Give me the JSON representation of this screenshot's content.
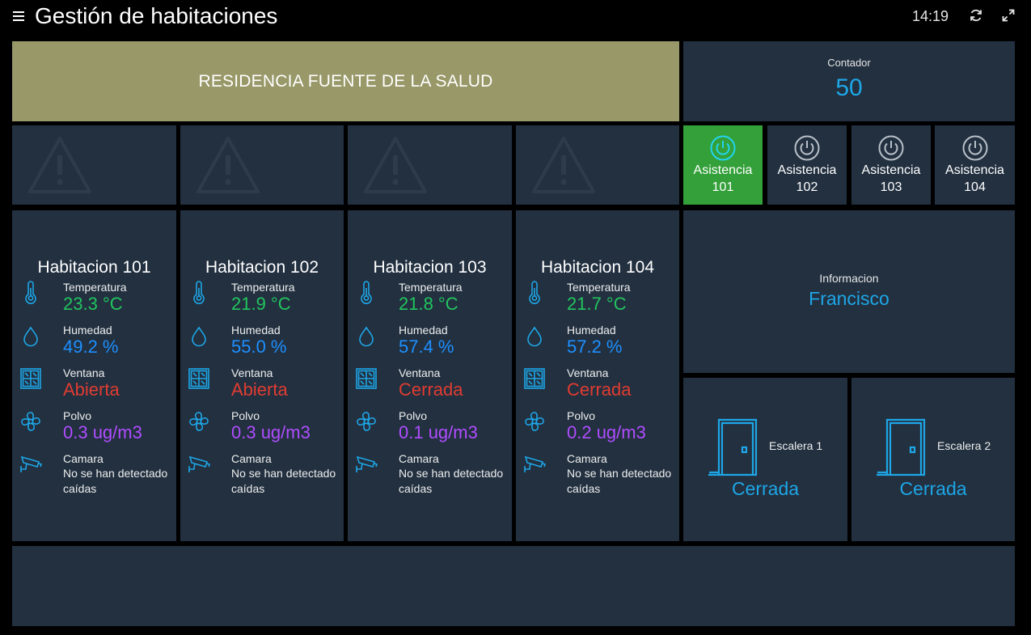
{
  "header": {
    "title": "Gestión de habitaciones",
    "clock": "14:19",
    "menu_icon": "hamburger-icon",
    "refresh_icon": "refresh-icon",
    "fullscreen_icon": "fullscreen-icon"
  },
  "banner": {
    "text": "RESIDENCIA FUENTE DE LA SALUD",
    "color": "#989868"
  },
  "counter": {
    "label": "Contador",
    "value": "50"
  },
  "warnings": [
    {
      "icon": "warning-icon"
    },
    {
      "icon": "warning-icon"
    },
    {
      "icon": "warning-icon"
    },
    {
      "icon": "warning-icon"
    }
  ],
  "assistance": [
    {
      "line1": "Asistencia",
      "line2": "101",
      "active": true
    },
    {
      "line1": "Asistencia",
      "line2": "102",
      "active": false
    },
    {
      "line1": "Asistencia",
      "line2": "103",
      "active": false
    },
    {
      "line1": "Asistencia",
      "line2": "104",
      "active": false
    }
  ],
  "rooms": [
    {
      "title": "Habitacion 101",
      "temperature": {
        "label": "Temperatura",
        "value": "23.3 °C"
      },
      "humidity": {
        "label": "Humedad",
        "value": "49.2 %"
      },
      "window": {
        "label": "Ventana",
        "value": "Abierta"
      },
      "dust": {
        "label": "Polvo",
        "value": "0.3 ug/m3"
      },
      "camera": {
        "label": "Camara",
        "value": "No se han detectado caídas"
      }
    },
    {
      "title": "Habitacion 102",
      "temperature": {
        "label": "Temperatura",
        "value": "21.9 °C"
      },
      "humidity": {
        "label": "Humedad",
        "value": "55.0 %"
      },
      "window": {
        "label": "Ventana",
        "value": "Abierta"
      },
      "dust": {
        "label": "Polvo",
        "value": "0.3 ug/m3"
      },
      "camera": {
        "label": "Camara",
        "value": "No se han detectado caídas"
      }
    },
    {
      "title": "Habitacion 103",
      "temperature": {
        "label": "Temperatura",
        "value": "21.8 °C"
      },
      "humidity": {
        "label": "Humedad",
        "value": "57.4 %"
      },
      "window": {
        "label": "Ventana",
        "value": "Cerrada"
      },
      "dust": {
        "label": "Polvo",
        "value": "0.1 ug/m3"
      },
      "camera": {
        "label": "Camara",
        "value": "No se han detectado caídas"
      }
    },
    {
      "title": "Habitacion 104",
      "temperature": {
        "label": "Temperatura",
        "value": "21.7 °C"
      },
      "humidity": {
        "label": "Humedad",
        "value": "57.2 %"
      },
      "window": {
        "label": "Ventana",
        "value": "Cerrada"
      },
      "dust": {
        "label": "Polvo",
        "value": "0.2 ug/m3"
      },
      "camera": {
        "label": "Camara",
        "value": "No se han detectado caídas"
      }
    }
  ],
  "information": {
    "label": "Informacion",
    "value": "Francisco"
  },
  "doors": [
    {
      "label": "Escalera 1",
      "status": "Cerrada"
    },
    {
      "label": "Escalera 2",
      "status": "Cerrada"
    }
  ],
  "colors": {
    "background": "#000000",
    "tile": "#223040",
    "accent": "#1ea6e6",
    "active_button": "#34a03a",
    "temperature": "#22c55e",
    "humidity": "#1e90ff",
    "window": "#e03c31",
    "dust": "#b04dff"
  }
}
